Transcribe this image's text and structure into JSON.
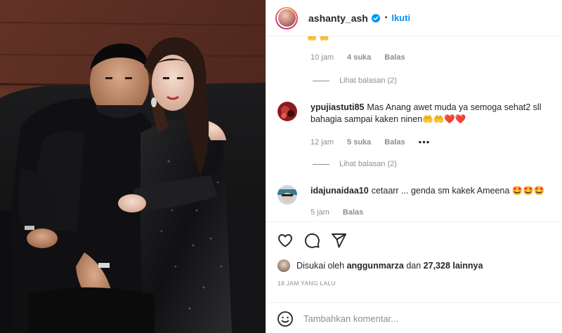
{
  "header": {
    "username": "ashanty_ash",
    "separator": "•",
    "follow_label": "Ikuti"
  },
  "comments": {
    "partial_top_emoji": "🤲🤲",
    "first_meta": {
      "time": "10 jam",
      "likes": "4 suka",
      "reply": "Balas"
    },
    "first_replies": "Lihat balasan (2)",
    "items": [
      {
        "username": "ypujiastuti85",
        "text": "Mas Anang awet muda ya semoga sehat2 sll bahagia sampai kaken ninen🤲🤲❤️❤️",
        "time": "12 jam",
        "likes": "5 suka",
        "reply": "Balas",
        "more": "•••",
        "replies": "Lihat balasan (2)"
      },
      {
        "username": "idajunaidaa10",
        "text": "cetaarr ... genda sm kakek Ameena 🤩🤩🤩",
        "time": "5 jam",
        "reply": "Balas"
      }
    ]
  },
  "actions": {
    "icons": [
      "heart-icon",
      "comment-icon",
      "share-icon"
    ],
    "liked_by_prefix": "Disukai oleh",
    "liked_by_user": "anggunmarza",
    "liked_by_and": "dan",
    "liked_by_count": "27,328 lainnya",
    "timestamp": "18 JAM YANG LALU"
  },
  "add_comment": {
    "placeholder": "Tambahkan komentar..."
  },
  "colors": {
    "accent": "#0095f6",
    "muted": "#8e8e8e",
    "text": "#262626",
    "border": "#efefef"
  }
}
